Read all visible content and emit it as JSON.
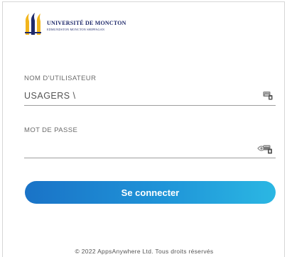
{
  "logo": {
    "university_name": "UNIVERSITÉ DE MONCTON",
    "campuses": "EDMUNDSTON  MONCTON  SHIPPAGAN",
    "icon": "university-logo-flames",
    "colors": {
      "gold": "#f2b51c",
      "navy": "#1f2a6b"
    }
  },
  "username": {
    "label": "NOM D'UTILISATEUR",
    "value": "USAGERS \\",
    "icon": "keyboard-icon"
  },
  "password": {
    "label": "MOT DE PASSE",
    "value": "",
    "icon": "show-password-keyboard-icon"
  },
  "connect_button": {
    "label": "Se connecter",
    "colors": {
      "start": "#1a73c7",
      "end": "#2bb7e3"
    }
  },
  "footer": {
    "text": "© 2022 AppsAnywhere Ltd. Tous droits réservés"
  }
}
